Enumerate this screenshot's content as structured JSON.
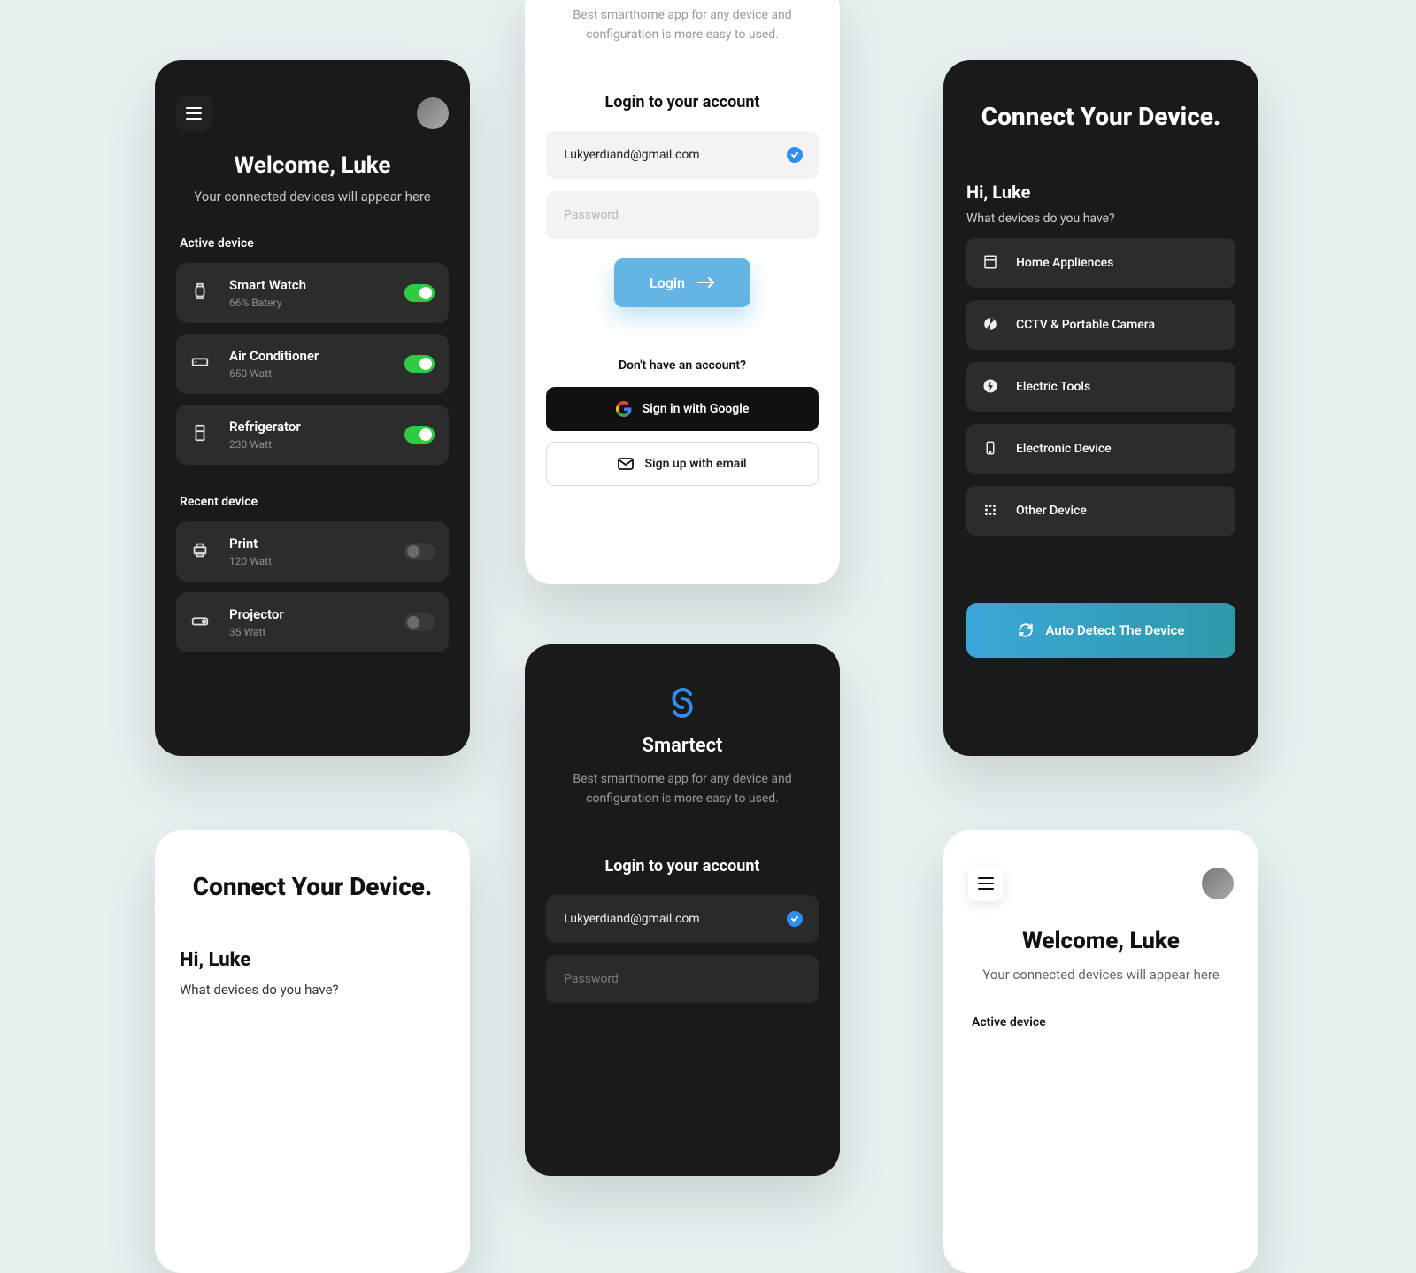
{
  "welcome": {
    "title": "Welcome, Luke",
    "subtitle": "Your connected devices will appear here",
    "active_label": "Active device",
    "recent_label": "Recent device",
    "active": [
      {
        "name": "Smart Watch",
        "meta": "66% Batery",
        "on": true
      },
      {
        "name": "Air Conditioner",
        "meta": "650 Watt",
        "on": true
      },
      {
        "name": "Refrigerator",
        "meta": "230 Watt",
        "on": true
      }
    ],
    "recent": [
      {
        "name": "Print",
        "meta": "120 Watt",
        "on": false
      },
      {
        "name": "Projector",
        "meta": "35 Watt",
        "on": false
      }
    ]
  },
  "login": {
    "tagline": "Best smarthome app for any device and configuration is more easy to used.",
    "heading": "Login to your account",
    "email": "Lukyerdiand@gmail.com",
    "password_placeholder": "Password",
    "login_label": "Login",
    "alt_prompt": "Don't have an account?",
    "google_label": "Sign in with Google",
    "email_label": "Sign up with email",
    "brand": "Smartect"
  },
  "connect": {
    "title": "Connect Your Device.",
    "hi": "Hi, Luke",
    "question": "What devices do you have?",
    "categories": [
      "Home Appliences",
      "CCTV & Portable Camera",
      "Electric Tools",
      "Electronic Device",
      "Other Device"
    ],
    "auto_label": "Auto Detect The Device"
  }
}
